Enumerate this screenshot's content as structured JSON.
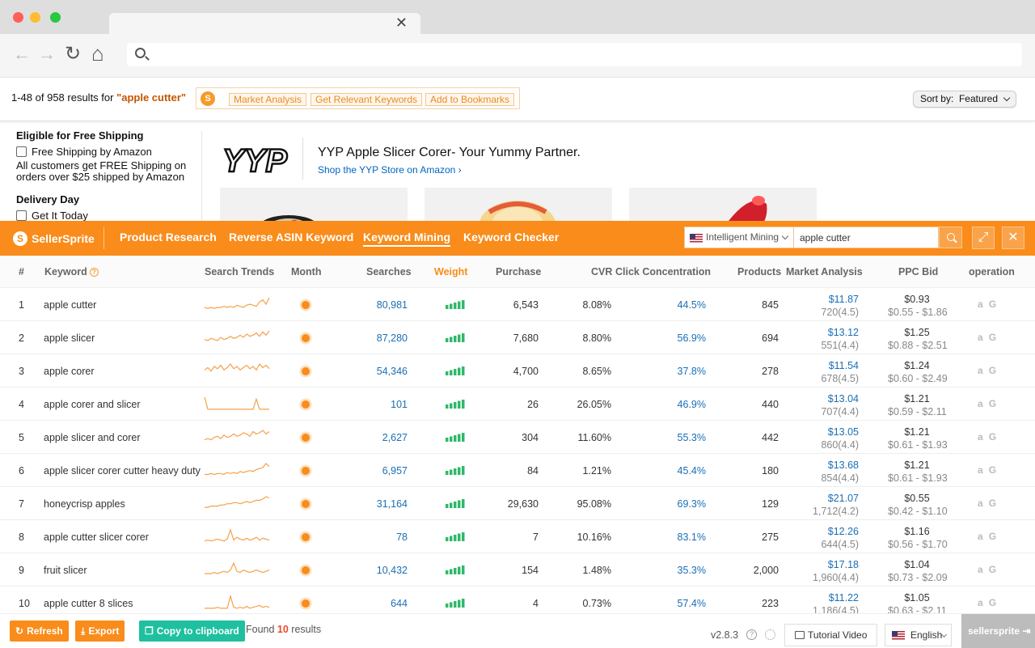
{
  "browser": {
    "close_glyph": "✕",
    "back_glyph": "←",
    "forward_glyph": "→",
    "reload_glyph": "↻",
    "home_glyph": "⌂"
  },
  "amazon": {
    "results_prefix": "1-48 of 958 results for ",
    "query": "\"apple cutter\"",
    "sellersprite_chips": [
      "Market Analysis",
      "Get Relevant Keywords",
      "Add to Bookmarks"
    ],
    "sort_label": "Sort by:",
    "sort_value": "Featured",
    "filters": {
      "shipping_heading": "Eligible for Free Shipping",
      "free_shipping_label": "Free Shipping by Amazon",
      "shipping_note": "All customers get FREE Shipping on orders over $25 shipped by Amazon",
      "delivery_heading": "Delivery Day",
      "get_it_today": "Get It Today"
    },
    "brand": {
      "logo_text": "YYP",
      "title": "YYP Apple Slicer Corer- Your Yummy Partner.",
      "link": "Shop the YYP Store on Amazon ›"
    }
  },
  "sellersprite": {
    "brand_name": "SellerSprite",
    "brand_mark": "S",
    "nav": [
      "Product Research",
      "Reverse ASIN Keyword",
      "Keyword Mining",
      "Keyword Checker"
    ],
    "active_nav": "Keyword Mining",
    "market_select": "Intelligent Mining",
    "keyword_value": "apple cutter",
    "expand_glyph": "⤢",
    "close_glyph": "✕",
    "columns": {
      "idx": "#",
      "keyword": "Keyword",
      "trends": "Search Trends",
      "month": "Month",
      "searches": "Searches",
      "weight": "Weight",
      "purchase": "Purchase",
      "cvr": "CVR",
      "click": "Click Concentration",
      "products": "Products",
      "market": "Market Analysis",
      "ppc": "PPC Bid",
      "operation": "operation"
    },
    "help_glyph": "?",
    "op_amazon": "a",
    "op_google": "G",
    "rows": [
      {
        "idx": "1",
        "keyword": "apple cutter",
        "searches": "80,981",
        "purchase": "6,543",
        "cvr": "8.08%",
        "click": "44.5%",
        "products": "845",
        "price": "$11.87",
        "reviews": "720(4.5)",
        "ppc": "$0.93",
        "ppc_range": "$0.55 - $1.86",
        "trend": [
          3,
          2,
          3,
          2,
          3,
          3,
          4,
          3,
          4,
          3,
          5,
          4,
          3,
          5,
          6,
          5,
          4,
          8,
          10,
          6,
          12
        ]
      },
      {
        "idx": "2",
        "keyword": "apple slicer",
        "searches": "87,280",
        "purchase": "7,680",
        "cvr": "8.80%",
        "click": "56.9%",
        "products": "694",
        "price": "$13.12",
        "reviews": "551(4.4)",
        "ppc": "$1.25",
        "ppc_range": "$0.88 - $2.51",
        "trend": [
          4,
          3,
          5,
          4,
          3,
          6,
          4,
          5,
          7,
          5,
          6,
          8,
          6,
          9,
          7,
          8,
          10,
          7,
          11,
          8,
          12
        ]
      },
      {
        "idx": "3",
        "keyword": "apple corer",
        "searches": "54,346",
        "purchase": "4,700",
        "cvr": "8.65%",
        "click": "37.8%",
        "products": "278",
        "price": "$11.54",
        "reviews": "678(4.5)",
        "ppc": "$1.24",
        "ppc_range": "$0.60 - $2.49",
        "trend": [
          6,
          8,
          5,
          9,
          7,
          10,
          6,
          8,
          11,
          7,
          9,
          6,
          8,
          10,
          7,
          9,
          6,
          11,
          8,
          10,
          7
        ]
      },
      {
        "idx": "4",
        "keyword": "apple corer and slicer",
        "searches": "101",
        "purchase": "26",
        "cvr": "26.05%",
        "click": "46.9%",
        "products": "440",
        "price": "$13.04",
        "reviews": "707(4.4)",
        "ppc": "$1.21",
        "ppc_range": "$0.59 - $2.11",
        "trend": [
          14,
          1,
          1,
          1,
          1,
          1,
          1,
          1,
          1,
          1,
          1,
          1,
          1,
          1,
          1,
          1,
          12,
          1,
          1,
          1,
          1
        ]
      },
      {
        "idx": "5",
        "keyword": "apple slicer and corer",
        "searches": "2,627",
        "purchase": "304",
        "cvr": "11.60%",
        "click": "55.3%",
        "products": "442",
        "price": "$13.05",
        "reviews": "860(4.4)",
        "ppc": "$1.21",
        "ppc_range": "$0.61 - $1.93",
        "trend": [
          3,
          4,
          3,
          5,
          6,
          4,
          7,
          5,
          6,
          8,
          6,
          7,
          9,
          8,
          6,
          10,
          8,
          9,
          11,
          8,
          10
        ]
      },
      {
        "idx": "6",
        "keyword": "apple slicer corer cutter heavy duty",
        "searches": "6,957",
        "purchase": "84",
        "cvr": "1.21%",
        "click": "45.4%",
        "products": "180",
        "price": "$13.68",
        "reviews": "854(4.4)",
        "ppc": "$1.21",
        "ppc_range": "$0.61 - $1.93",
        "trend": [
          2,
          2,
          3,
          2,
          3,
          3,
          2,
          4,
          3,
          4,
          3,
          5,
          4,
          5,
          6,
          5,
          7,
          8,
          9,
          13,
          10
        ]
      },
      {
        "idx": "7",
        "keyword": "honeycrisp apples",
        "searches": "31,164",
        "purchase": "29,630",
        "cvr": "95.08%",
        "click": "69.3%",
        "products": "129",
        "price": "$21.07",
        "reviews": "1,712(4.2)",
        "ppc": "$0.55",
        "ppc_range": "$0.42 - $1.10",
        "trend": [
          2,
          2,
          3,
          3,
          3,
          4,
          4,
          5,
          5,
          6,
          6,
          5,
          6,
          7,
          6,
          7,
          8,
          8,
          9,
          11,
          10
        ]
      },
      {
        "idx": "8",
        "keyword": "apple cutter slicer corer",
        "searches": "78",
        "purchase": "7",
        "cvr": "10.16%",
        "click": "83.1%",
        "products": "275",
        "price": "$12.26",
        "reviews": "644(4.5)",
        "ppc": "$1.16",
        "ppc_range": "$0.56 - $1.70",
        "trend": [
          2,
          3,
          2,
          3,
          4,
          3,
          2,
          4,
          14,
          3,
          6,
          4,
          3,
          5,
          3,
          4,
          6,
          3,
          5,
          4,
          3
        ]
      },
      {
        "idx": "9",
        "keyword": "fruit slicer",
        "searches": "10,432",
        "purchase": "154",
        "cvr": "1.48%",
        "click": "35.3%",
        "products": "2,000",
        "price": "$17.18",
        "reviews": "1,960(4.4)",
        "ppc": "$1.04",
        "ppc_range": "$0.73 - $2.09",
        "trend": [
          2,
          2,
          2,
          3,
          2,
          3,
          4,
          3,
          5,
          11,
          4,
          3,
          5,
          4,
          3,
          4,
          5,
          4,
          3,
          4,
          5
        ]
      },
      {
        "idx": "10",
        "keyword": "apple cutter 8 slices",
        "searches": "644",
        "purchase": "4",
        "cvr": "0.73%",
        "click": "57.4%",
        "products": "223",
        "price": "$11.22",
        "reviews": "1,186(4.5)",
        "ppc": "$1.05",
        "ppc_range": "$0.63 - $2.11",
        "trend": [
          1,
          1,
          1,
          1,
          2,
          1,
          1,
          1,
          14,
          2,
          1,
          2,
          1,
          3,
          1,
          2,
          3,
          4,
          2,
          3,
          2
        ]
      }
    ],
    "footer": {
      "refresh": "Refresh",
      "export": "Export",
      "copy": "Copy to clipboard",
      "found_prefix": "Found ",
      "found_count": "10",
      "found_suffix": " results",
      "version": "v2.8.3",
      "tutorial": "Tutorial Video",
      "language": "English",
      "account": "sellersprite"
    },
    "colors": {
      "accent": "#f98c1a",
      "link": "#1a6fb5",
      "weight_bar": "#2fb86a",
      "trend_line": "#f5a04a"
    }
  }
}
